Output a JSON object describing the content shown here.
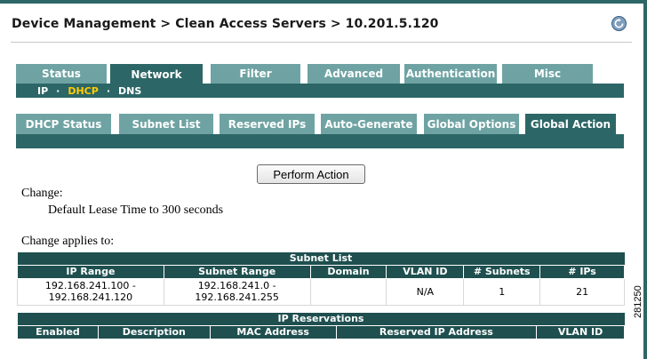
{
  "breadcrumb": "Device Management > Clean Access Servers > 10.201.5.120",
  "main_tabs": [
    {
      "label": "Status",
      "active": false
    },
    {
      "label": "Network",
      "active": true
    },
    {
      "label": "Filter",
      "active": false
    },
    {
      "label": "Advanced",
      "active": false
    },
    {
      "label": "Authentication",
      "active": false
    },
    {
      "label": "Misc",
      "active": false
    }
  ],
  "subnav": {
    "items": [
      "IP",
      "DHCP",
      "DNS"
    ],
    "current": "DHCP",
    "separator": "·"
  },
  "sub_tabs": [
    {
      "label": "DHCP Status",
      "active": false
    },
    {
      "label": "Subnet List",
      "active": false
    },
    {
      "label": "Reserved IPs",
      "active": false
    },
    {
      "label": "Auto-Generate",
      "active": false
    },
    {
      "label": "Global Options",
      "active": false
    },
    {
      "label": "Global Action",
      "active": true
    }
  ],
  "perform_button": "Perform Action",
  "change_label": "Change:",
  "change_detail": "Default Lease Time to 300 seconds",
  "applies_label": "Change applies to:",
  "subnet_table": {
    "caption": "Subnet List",
    "headers": [
      "IP Range",
      "Subnet Range",
      "Domain",
      "VLAN ID",
      "# Subnets",
      "# IPs"
    ],
    "rows": [
      {
        "ip_range": [
          "192.168.241.100 -",
          "192.168.241.120"
        ],
        "subnet_range": [
          "192.168.241.0 -",
          "192.168.241.255"
        ],
        "domain": "",
        "vlan_id": "N/A",
        "subnets": "1",
        "ips": "21"
      }
    ]
  },
  "reservations_table": {
    "caption": "IP Reservations",
    "headers": [
      "Enabled",
      "Description",
      "MAC Address",
      "Reserved IP Address",
      "VLAN ID"
    ]
  },
  "figure_number": "281250",
  "colors": {
    "tab_active": "#2d6666",
    "tab_inactive": "#6fa3a3",
    "table_header": "#1f4f4f",
    "current_subnav": "#ffcc00"
  },
  "icons": {
    "help": "refresh-help-icon"
  }
}
